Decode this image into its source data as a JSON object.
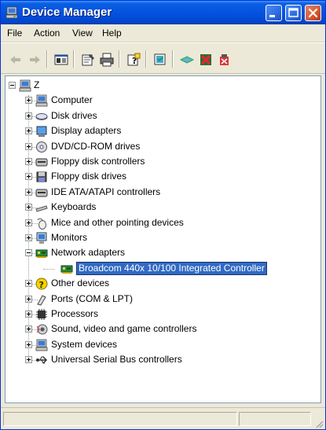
{
  "window": {
    "title": "Device Manager",
    "title_icon": "computer-icon",
    "controls": [
      "minimize",
      "maximize",
      "close"
    ]
  },
  "menu": {
    "items": [
      "File",
      "Action",
      "View",
      "Help"
    ]
  },
  "toolbar": {
    "buttons": [
      "back-arrow-icon",
      "forward-arrow-icon",
      "show-hide-console-tree-icon",
      "properties-icon",
      "print-icon",
      "help-icon",
      "scan-hardware-icon",
      "update-driver-icon",
      "disable-device-icon",
      "uninstall-device-icon"
    ]
  },
  "tree": {
    "root": {
      "label": "Z",
      "icon": "computer-icon"
    },
    "items": [
      {
        "label": "Computer",
        "icon": "computer-icon",
        "expanded": false
      },
      {
        "label": "Disk drives",
        "icon": "disk-drive-icon",
        "expanded": false
      },
      {
        "label": "Display adapters",
        "icon": "display-adapter-icon",
        "expanded": false
      },
      {
        "label": "DVD/CD-ROM drives",
        "icon": "cd-drive-icon",
        "expanded": false
      },
      {
        "label": "Floppy disk controllers",
        "icon": "floppy-controller-icon",
        "expanded": false
      },
      {
        "label": "Floppy disk drives",
        "icon": "floppy-drive-icon",
        "expanded": false
      },
      {
        "label": "IDE ATA/ATAPI controllers",
        "icon": "ide-controller-icon",
        "expanded": false
      },
      {
        "label": "Keyboards",
        "icon": "keyboard-icon",
        "expanded": false
      },
      {
        "label": "Mice and other pointing devices",
        "icon": "mouse-icon",
        "expanded": false
      },
      {
        "label": "Monitors",
        "icon": "monitor-icon",
        "expanded": false
      },
      {
        "label": "Network adapters",
        "icon": "network-adapter-icon",
        "expanded": true,
        "children": [
          {
            "label": "Broadcom 440x 10/100 Integrated Controller",
            "icon": "network-card-icon",
            "selected": true
          }
        ]
      },
      {
        "label": "Other devices",
        "icon": "unknown-device-icon",
        "expanded": false
      },
      {
        "label": "Ports (COM & LPT)",
        "icon": "port-icon",
        "expanded": false
      },
      {
        "label": "Processors",
        "icon": "processor-icon",
        "expanded": false
      },
      {
        "label": "Sound, video and game controllers",
        "icon": "sound-icon",
        "expanded": false
      },
      {
        "label": "System devices",
        "icon": "system-device-icon",
        "expanded": false
      },
      {
        "label": "Universal Serial Bus controllers",
        "icon": "usb-icon",
        "expanded": false
      }
    ]
  },
  "colors": {
    "titlebar": "#0553e1",
    "selection": "#316ac5",
    "chrome": "#ece9d8"
  }
}
